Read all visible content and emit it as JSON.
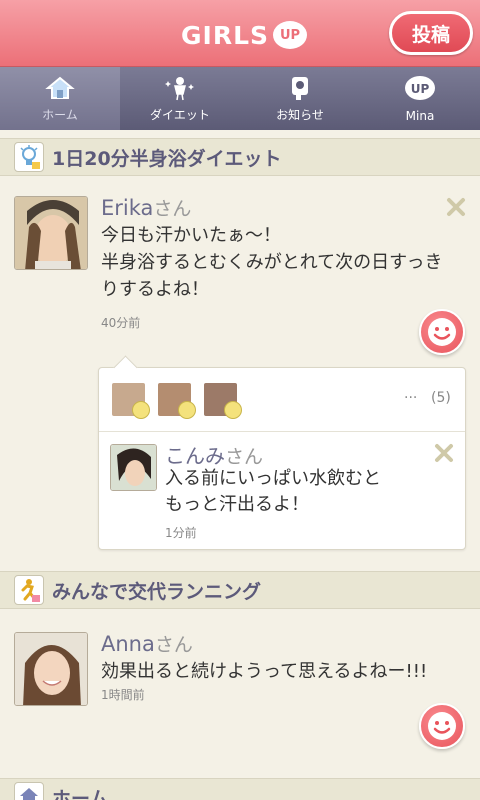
{
  "header": {
    "logo_text": "GIRLS",
    "logo_badge": "UP",
    "post_button": "投稿"
  },
  "tabs": [
    {
      "label": "ホーム",
      "icon": "home-icon",
      "active": true
    },
    {
      "label": "ダイエット",
      "icon": "diet-icon",
      "active": false
    },
    {
      "label": "お知らせ",
      "icon": "notice-icon",
      "active": false
    },
    {
      "label": "Mina",
      "icon": "up-badge-icon",
      "active": false
    }
  ],
  "sections": [
    {
      "title": "1日20分半身浴ダイエット",
      "icon": "lightbulb-icon",
      "post": {
        "name": "Erika",
        "suffix": "さん",
        "text_lines": [
          "今日も汗かいたぁ〜！",
          "半身浴するとむくみがとれて次の日すっき",
          "りするよね！"
        ],
        "time": "40分前"
      },
      "reactions": {
        "dots": "···",
        "count": "(5)"
      },
      "reply": {
        "name": "こんみ",
        "suffix": "さん",
        "text_lines": [
          "入る前にいっぱい水飲むと",
          "もっと汗出るよ！"
        ],
        "time": "1分前"
      }
    },
    {
      "title": "みんなで交代ランニング",
      "icon": "runner-icon",
      "post": {
        "name": "Anna",
        "suffix": "さん",
        "text_lines": [
          "効果出ると続けようって思えるよねー!!!"
        ],
        "time": "1時間前"
      }
    },
    {
      "title": "ホーム",
      "icon": "home-icon"
    }
  ],
  "colors": {
    "header_pink": "#ec7078",
    "tabbar": "#5c5b76",
    "background": "#f4f1e6",
    "accent_name": "#6c6c8c"
  }
}
